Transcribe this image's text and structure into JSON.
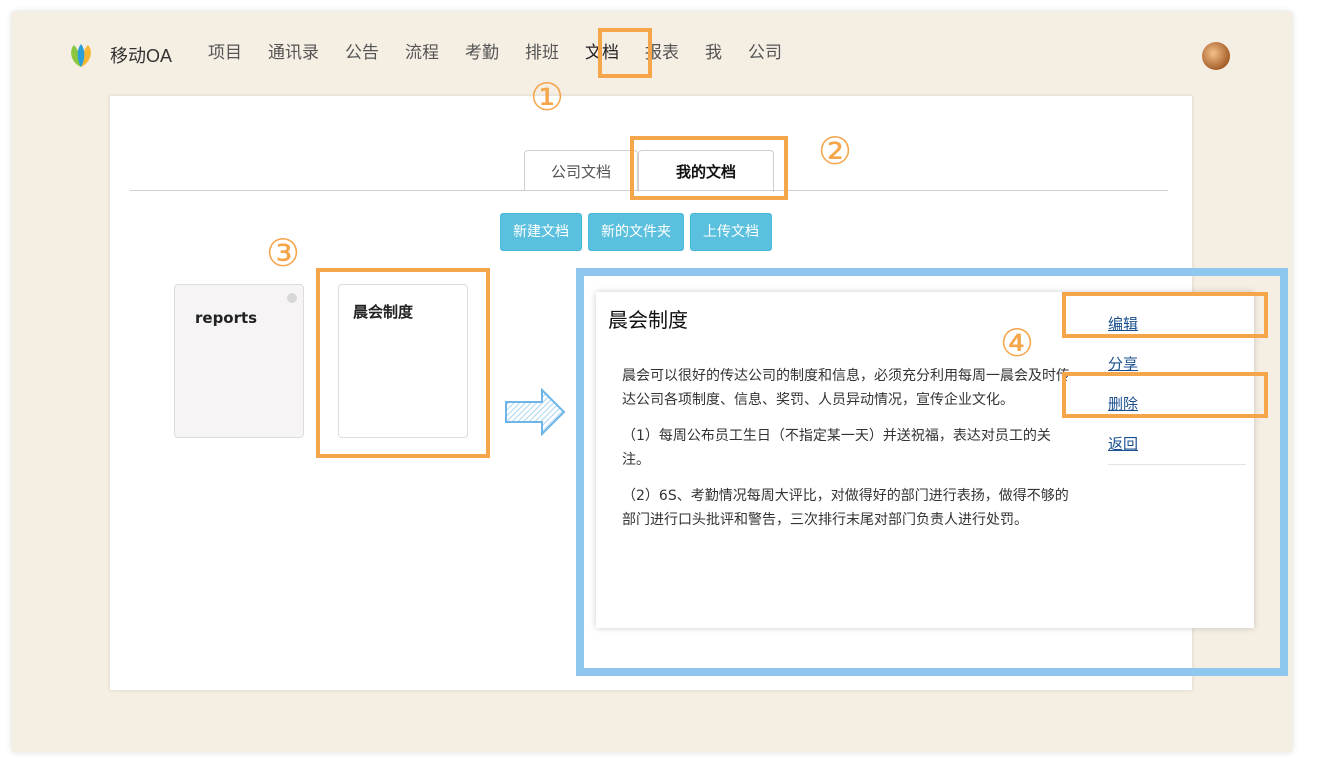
{
  "app": {
    "brand": "移动OA",
    "nav": [
      "项目",
      "通讯录",
      "公告",
      "流程",
      "考勤",
      "排班",
      "文档",
      "报表",
      "我",
      "公司"
    ],
    "active_nav_index": 6
  },
  "tabs": {
    "company_docs": "公司文档",
    "my_docs": "我的文档",
    "active": "my_docs"
  },
  "toolbar": {
    "new_doc": "新建文档",
    "new_folder": "新的文件夹",
    "upload_doc": "上传文档"
  },
  "documents": [
    {
      "title": "reports"
    },
    {
      "title": "晨会制度"
    }
  ],
  "preview": {
    "title": "晨会制度",
    "paragraphs": [
      "晨会可以很好的传达公司的制度和信息，必须充分利用每周一晨会及时传达公司各项制度、信息、奖罚、人员异动情况，宣传企业文化。",
      "（1）每周公布员工生日（不指定某一天）并送祝福，表达对员工的关注。",
      "（2）6S、考勤情况每周大评比，对做得好的部门进行表扬，做得不够的部门进行口头批评和警告，三次排行末尾对部门负责人进行处罚。"
    ],
    "actions": {
      "edit": "编辑",
      "share": "分享",
      "delete": "删除",
      "back": "返回"
    }
  },
  "annotations": {
    "n1": "①",
    "n2": "②",
    "n3": "③",
    "n4": "④",
    "highlight_color": "#f5a54a",
    "preview_border_color": "#8fc7ee"
  },
  "colors": {
    "background": "#f5eee3",
    "button": "#5bc0de",
    "link": "#1a4f8f"
  }
}
